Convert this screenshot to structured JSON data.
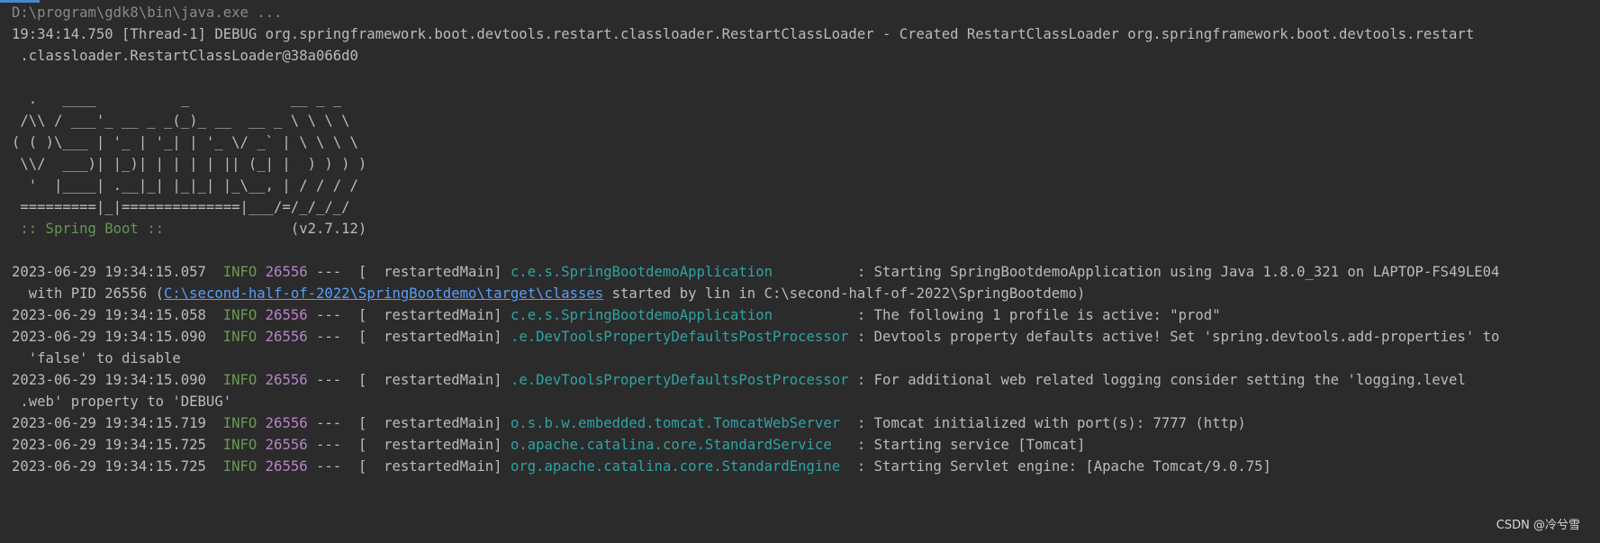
{
  "command": "D:\\program\\gdk8\\bin\\java.exe ...",
  "debug": {
    "line1": "19:34:14.750 [Thread-1] DEBUG org.springframework.boot.devtools.restart.classloader.RestartClassLoader - Created RestartClassLoader org.springframework.boot.devtools.restart",
    "line2": " .classloader.RestartClassLoader@38a066d0"
  },
  "banner": {
    "l1": "  .   ____          _            __ _ _",
    "l2": " /\\\\ / ___'_ __ _ _(_)_ __  __ _ \\ \\ \\ \\",
    "l3": "( ( )\\___ | '_ | '_| | '_ \\/ _` | \\ \\ \\ \\",
    "l4": " \\\\/  ___)| |_)| | | | | || (_| |  ) ) ) )",
    "l5": "  '  |____| .__|_| |_|_| |_\\__, | / / / /",
    "l6": " =========|_|==============|___/=/_/_/_/",
    "spring_boot_label": " :: Spring Boot ::",
    "version": "               (v2.7.12)"
  },
  "logs": [
    {
      "ts": "2023-06-29 19:34:15.057",
      "level": "INFO",
      "pid": "26556",
      "thread": "---  [  restartedMain]",
      "logger": "c.e.s.SpringBootdemoApplication",
      "pad": "          ",
      "message": ": Starting SpringBootdemoApplication using Java 1.8.0_321 on LAPTOP-FS49LE04"
    },
    {
      "ts": "2023-06-29 19:34:15.058",
      "level": "INFO",
      "pid": "26556",
      "thread": "---  [  restartedMain]",
      "logger": "c.e.s.SpringBootdemoApplication",
      "pad": "          ",
      "message": ": The following 1 profile is active: \"prod\""
    },
    {
      "ts": "2023-06-29 19:34:15.090",
      "level": "INFO",
      "pid": "26556",
      "thread": "---  [  restartedMain]",
      "logger": ".e.DevToolsPropertyDefaultsPostProcessor",
      "pad": " ",
      "message": ": Devtools property defaults active! Set 'spring.devtools.add-properties' to"
    },
    {
      "ts": "2023-06-29 19:34:15.090",
      "level": "INFO",
      "pid": "26556",
      "thread": "---  [  restartedMain]",
      "logger": ".e.DevToolsPropertyDefaultsPostProcessor",
      "pad": " ",
      "message": ": For additional web related logging consider setting the 'logging.level"
    },
    {
      "ts": "2023-06-29 19:34:15.719",
      "level": "INFO",
      "pid": "26556",
      "thread": "---  [  restartedMain]",
      "logger": "o.s.b.w.embedded.tomcat.TomcatWebServer",
      "pad": "  ",
      "message": ": Tomcat initialized with port(s): 7777 (http)"
    },
    {
      "ts": "2023-06-29 19:34:15.725",
      "level": "INFO",
      "pid": "26556",
      "thread": "---  [  restartedMain]",
      "logger": "o.apache.catalina.core.StandardService",
      "pad": "   ",
      "message": ": Starting service [Tomcat]"
    },
    {
      "ts": "2023-06-29 19:34:15.725",
      "level": "INFO",
      "pid": "26556",
      "thread": "---  [  restartedMain]",
      "logger": "org.apache.catalina.core.StandardEngine",
      "pad": "  ",
      "message": ": Starting Servlet engine: [Apache Tomcat/9.0.75]"
    }
  ],
  "continuations": {
    "c1_prefix": "  with PID 26556 (",
    "c1_link": "C:\\second-half-of-2022\\SpringBootdemo\\target\\classes",
    "c1_suffix": " started by lin in C:\\second-half-of-2022\\SpringBootdemo)",
    "c3": "  'false' to disable",
    "c4": " .web' property to 'DEBUG'"
  },
  "watermark": "CSDN @冷兮雪",
  "colors": {
    "background": "#2b2b2b",
    "text": "#bbbbbb",
    "info_level": "#6a9955",
    "pid": "#b982c9",
    "logger": "#2fa3a3",
    "link": "#589df6"
  }
}
